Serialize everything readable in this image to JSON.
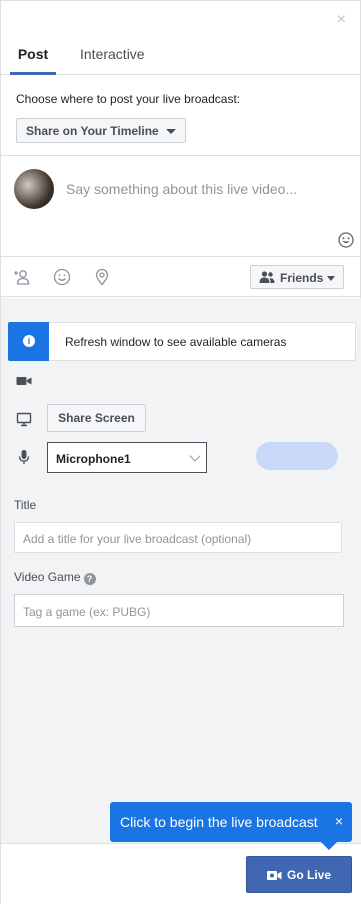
{
  "header": {
    "close_symbol": "×"
  },
  "tabs": [
    {
      "label": "Post"
    },
    {
      "label": "Interactive"
    }
  ],
  "post": {
    "choose_label": "Choose where to post your live broadcast:",
    "destination": "Share on Your Timeline",
    "compose_placeholder": "Say something about this live video...",
    "audience": "Friends"
  },
  "icons": {
    "tag_people": "tag-people-icon",
    "feeling": "smiley-icon",
    "location": "location-pin-icon",
    "emoji": "emoji-icon",
    "audience": "friends-icon",
    "info": "info-icon",
    "camera": "video-camera-icon",
    "screen": "monitor-icon",
    "microphone": "microphone-icon",
    "help": "question-icon",
    "go_live": "camera-icon"
  },
  "settings": {
    "notice_icon_glyph": "i",
    "notice": "Refresh window to see available cameras",
    "share_screen": "Share Screen",
    "microphone": "Microphone1",
    "mic_level": 0,
    "title_label": "Title",
    "title_placeholder": "Add a title for your live broadcast (optional)",
    "game_label": "Video Game",
    "game_help_glyph": "?",
    "game_placeholder": "Tag a game (ex: PUBG)"
  },
  "tooltip": {
    "text": "Click to begin the live broadcast",
    "close_symbol": "×"
  },
  "footer": {
    "go_live": "Go Live"
  },
  "colors": {
    "brand": "#4267b2",
    "tooltip_blue": "#1b74e4",
    "mic_meter": "#c8d9f8",
    "panel_gray": "#f2f3f5"
  }
}
